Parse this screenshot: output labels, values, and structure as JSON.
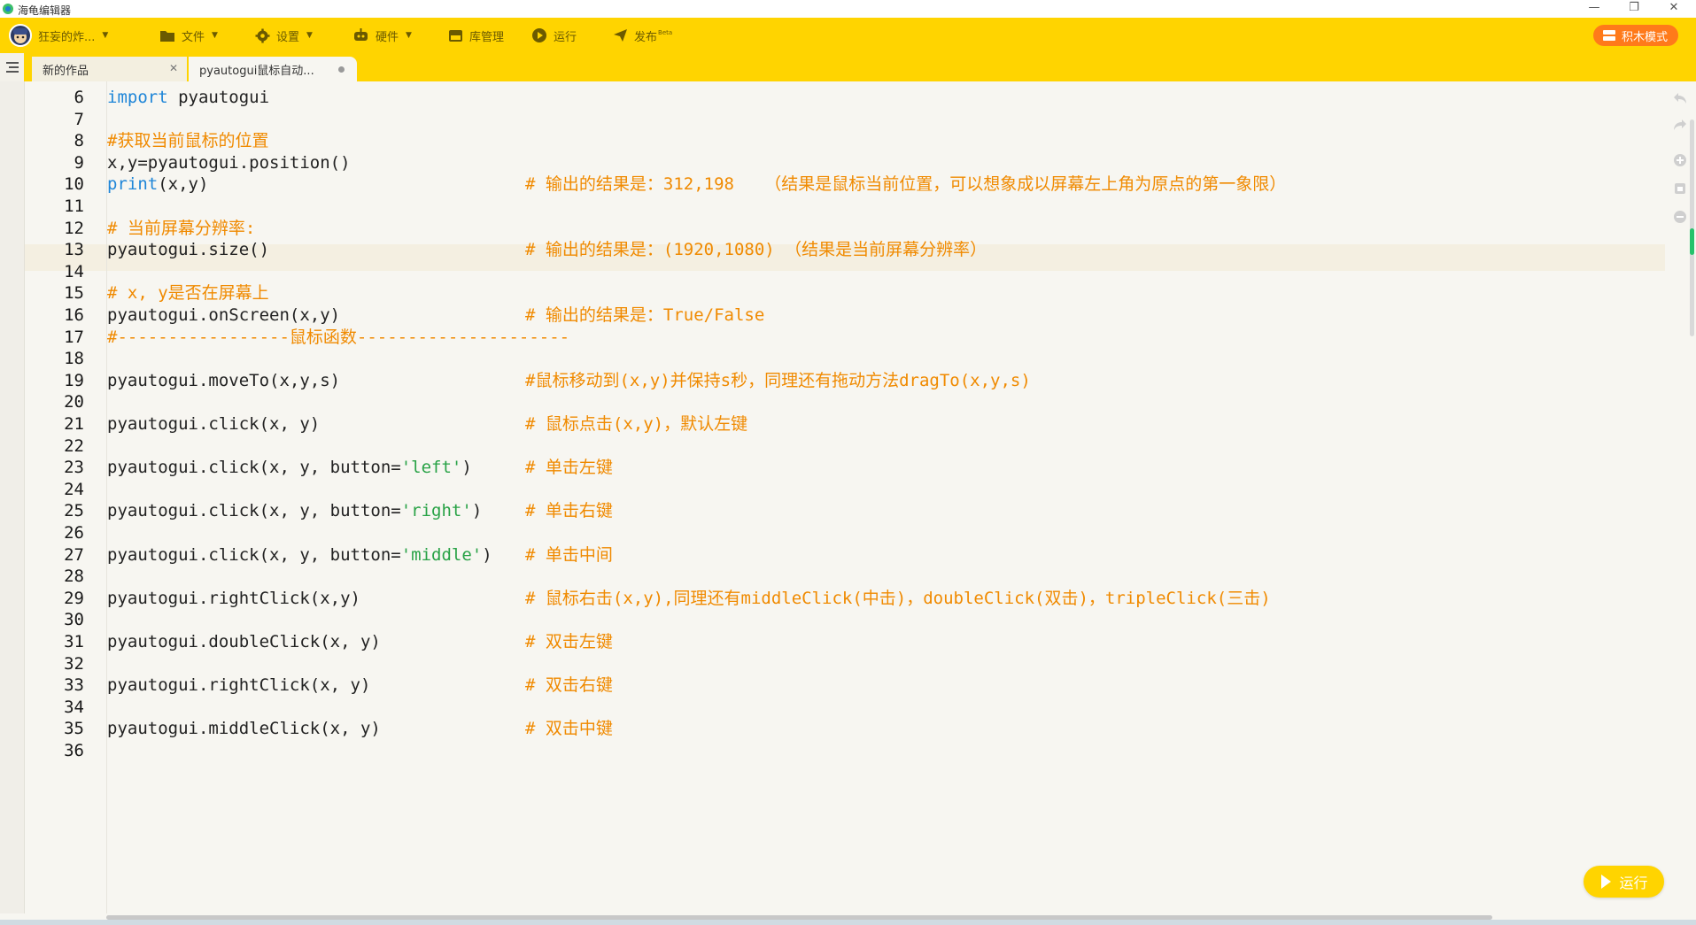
{
  "window": {
    "title": "海龟编辑器",
    "minimize": "—",
    "restore": "❐",
    "close": "✕"
  },
  "menubar": {
    "user": "狂妄的炸...",
    "items": [
      {
        "id": "file",
        "label": "文件",
        "icon": "folder-icon"
      },
      {
        "id": "settings",
        "label": "设置",
        "icon": "gear-icon"
      },
      {
        "id": "hardware",
        "label": "硬件",
        "icon": "robot-icon"
      },
      {
        "id": "library",
        "label": "库管理",
        "icon": "library-icon"
      },
      {
        "id": "run",
        "label": "运行",
        "icon": "play-icon"
      },
      {
        "id": "publish",
        "label": "发布",
        "badge": "Beta",
        "icon": "send-icon"
      }
    ],
    "block_mode": "积木模式"
  },
  "tabs": [
    {
      "label": "新的作品",
      "close": "✕"
    },
    {
      "label": "pyautogui鼠标自动...",
      "active": true
    }
  ],
  "code": {
    "lines": [
      {
        "n": "6",
        "code": "",
        "comment": ""
      },
      {
        "n": "7",
        "code": "",
        "comment": ""
      },
      {
        "n": "8",
        "code": "",
        "comment": ""
      },
      {
        "n": "9",
        "code": "x,y=pyautogui.position()",
        "comment": ""
      },
      {
        "n": "10",
        "code": "(x,y)",
        "comment": "# 输出的结果是：312,198   （结果是鼠标当前位置，可以想象成以屏幕左上角为原点的第一象限）"
      },
      {
        "n": "11",
        "code": "",
        "comment": ""
      },
      {
        "n": "12",
        "code": "",
        "comment": ""
      },
      {
        "n": "13",
        "code": "pyautogui.size()",
        "comment": "# 输出的结果是：(1920,1080) （结果是当前屏幕分辨率）"
      },
      {
        "n": "14",
        "code": "",
        "comment": ""
      },
      {
        "n": "15",
        "code": "",
        "comment": ""
      },
      {
        "n": "16",
        "code": "pyautogui.onScreen(x,y)",
        "comment": "# 输出的结果是：True/False"
      },
      {
        "n": "17",
        "code": "",
        "comment": ""
      },
      {
        "n": "18",
        "code": "",
        "comment": ""
      },
      {
        "n": "19",
        "code": "pyautogui.moveTo(x,y,s)",
        "comment": "#鼠标移动到(x,y)并保持s秒，同理还有拖动方法dragTo(x,y,s)"
      },
      {
        "n": "20",
        "code": "",
        "comment": ""
      },
      {
        "n": "21",
        "code": "pyautogui.click(x, y)",
        "comment": "# 鼠标点击(x,y)，默认左键"
      },
      {
        "n": "22",
        "code": "",
        "comment": ""
      },
      {
        "n": "23",
        "code": "",
        "comment": "# 单击左键"
      },
      {
        "n": "24",
        "code": "",
        "comment": ""
      },
      {
        "n": "25",
        "code": "",
        "comment": "# 单击右键"
      },
      {
        "n": "26",
        "code": "",
        "comment": ""
      },
      {
        "n": "27",
        "code": "",
        "comment": "# 单击中间"
      },
      {
        "n": "28",
        "code": "",
        "comment": ""
      },
      {
        "n": "29",
        "code": "pyautogui.rightClick(x,y)",
        "comment": "# 鼠标右击(x,y),同理还有middleClick(中击)，doubleClick(双击)，tripleClick(三击)"
      },
      {
        "n": "30",
        "code": "",
        "comment": ""
      },
      {
        "n": "31",
        "code": "pyautogui.doubleClick(x, y)",
        "comment": "# 双击左键"
      },
      {
        "n": "32",
        "code": "",
        "comment": ""
      },
      {
        "n": "33",
        "code": "pyautogui.rightClick(x, y)",
        "comment": "# 双击右键"
      },
      {
        "n": "34",
        "code": "",
        "comment": ""
      },
      {
        "n": "35",
        "code": "pyautogui.middleClick(x, y)",
        "comment": "# 双击中键"
      },
      {
        "n": "36",
        "code": "",
        "comment": ""
      }
    ],
    "line6": {
      "kw": "import",
      "rest": " pyautogui"
    },
    "line8": "#获取当前鼠标的位置",
    "line10_kw": "print",
    "line12": "# 当前屏幕分辨率:",
    "line15": "# x, y是否在屏幕上",
    "line17": "#-----------------鼠标函数---------------------",
    "line23": {
      "pre": "pyautogui.click(x, y, button=",
      "str": "'left'",
      "post": ")"
    },
    "line25": {
      "pre": "pyautogui.click(x, y, button=",
      "str": "'right'",
      "post": ")"
    },
    "line27": {
      "pre": "pyautogui.click(x, y, button=",
      "str": "'middle'",
      "post": ")"
    }
  },
  "run_button": "运行",
  "colors": {
    "accent": "#ffd400",
    "keyword": "#1f86d8",
    "string": "#28a246",
    "comment": "#f08a00",
    "block_mode": "#ff7a1a"
  }
}
